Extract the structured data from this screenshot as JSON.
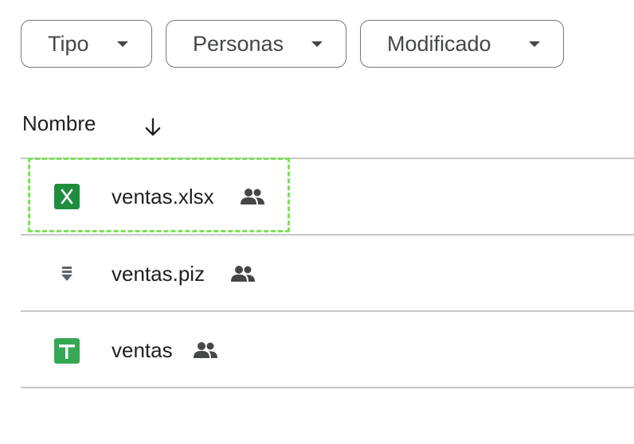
{
  "filters": {
    "tipo": "Tipo",
    "personas": "Personas",
    "modificado": "Modificado"
  },
  "list_header": {
    "name_label": "Nombre",
    "sort_icon": "arrow-down-icon"
  },
  "files": [
    {
      "name": "ventas.xlsx",
      "icon": "excel-file-icon",
      "icon_color": "#1e8e3e",
      "shared": true
    },
    {
      "name": "ventas.piz",
      "icon": "compressed-file-icon",
      "icon_color": "#5f6368",
      "shared": true
    },
    {
      "name": "ventas",
      "icon": "google-sheets-icon",
      "icon_color": "#34a853",
      "shared": true
    }
  ],
  "colors": {
    "focus_outline": "#7ae356"
  }
}
